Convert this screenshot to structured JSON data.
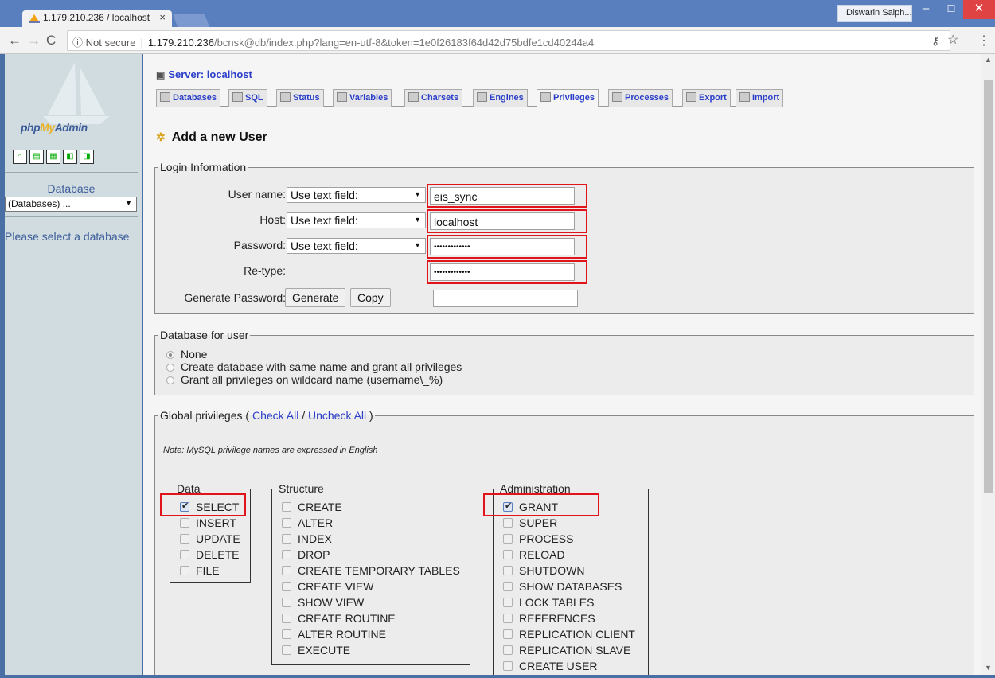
{
  "browser": {
    "tab_title": "1.179.210.236 / localhost",
    "tab_close": "×",
    "user_name": "Diswarin Saiph...",
    "win_min": "–",
    "win_max": "☐",
    "win_close": "✕",
    "nav_back": "←",
    "nav_forward": "→",
    "nav_reload": "C",
    "security_label": "ⓘ Not secure",
    "url_host": "1.179.210.236",
    "url_path": "/bcnsk@db/index.php?lang=en-utf-8&token=1e0f26183f64d42d75bdfe1cd40244a4",
    "key_icon": "⚷",
    "star_icon": "☆",
    "menu_icon": "⋮"
  },
  "sidebar": {
    "logo_text_1": "php",
    "logo_text_2": "My",
    "logo_text_3": "Admin",
    "db_label": "Database",
    "db_select_value": "(Databases) ...",
    "message": "Please select a database"
  },
  "server": {
    "title": "Server: localhost",
    "tabs": [
      {
        "label": "Databases"
      },
      {
        "label": "SQL"
      },
      {
        "label": "Status"
      },
      {
        "label": "Variables"
      },
      {
        "label": "Charsets"
      },
      {
        "label": "Engines"
      },
      {
        "label": "Privileges"
      },
      {
        "label": "Processes"
      },
      {
        "label": "Export"
      },
      {
        "label": "Import"
      }
    ]
  },
  "page": {
    "heading": "Add a new User"
  },
  "login": {
    "legend": "Login Information",
    "username_label": "User name:",
    "username_mode": "Use text field:",
    "username_value": "eis_sync",
    "host_label": "Host:",
    "host_mode": "Use text field:",
    "host_value": "localhost",
    "password_label": "Password:",
    "password_mode": "Use text field:",
    "password_value": "•••••••••••••",
    "retype_label": "Re-type:",
    "retype_value": "•••••••••••••",
    "generate_label": "Generate Password:",
    "generate_button": "Generate",
    "copy_button": "Copy",
    "generated_value": ""
  },
  "database_for_user": {
    "legend": "Database for user",
    "options": [
      {
        "label": "None",
        "selected": true
      },
      {
        "label": "Create database with same name and grant all privileges",
        "selected": false
      },
      {
        "label": "Grant all privileges on wildcard name (username\\_%)",
        "selected": false
      }
    ]
  },
  "global": {
    "legend_prefix": "Global privileges (",
    "check_all": "Check All",
    "slash": " / ",
    "uncheck_all": "Uncheck All",
    "legend_suffix": ")",
    "note": "Note: MySQL privilege names are expressed in English",
    "data_legend": "Data",
    "data": [
      {
        "label": "SELECT",
        "checked": true
      },
      {
        "label": "INSERT",
        "checked": false
      },
      {
        "label": "UPDATE",
        "checked": false
      },
      {
        "label": "DELETE",
        "checked": false
      },
      {
        "label": "FILE",
        "checked": false
      }
    ],
    "structure_legend": "Structure",
    "structure": [
      {
        "label": "CREATE",
        "checked": false
      },
      {
        "label": "ALTER",
        "checked": false
      },
      {
        "label": "INDEX",
        "checked": false
      },
      {
        "label": "DROP",
        "checked": false
      },
      {
        "label": "CREATE TEMPORARY TABLES",
        "checked": false
      },
      {
        "label": "CREATE VIEW",
        "checked": false
      },
      {
        "label": "SHOW VIEW",
        "checked": false
      },
      {
        "label": "CREATE ROUTINE",
        "checked": false
      },
      {
        "label": "ALTER ROUTINE",
        "checked": false
      },
      {
        "label": "EXECUTE",
        "checked": false
      }
    ],
    "admin_legend": "Administration",
    "admin": [
      {
        "label": "GRANT",
        "checked": true
      },
      {
        "label": "SUPER",
        "checked": false
      },
      {
        "label": "PROCESS",
        "checked": false
      },
      {
        "label": "RELOAD",
        "checked": false
      },
      {
        "label": "SHUTDOWN",
        "checked": false
      },
      {
        "label": "SHOW DATABASES",
        "checked": false
      },
      {
        "label": "LOCK TABLES",
        "checked": false
      },
      {
        "label": "REFERENCES",
        "checked": false
      },
      {
        "label": "REPLICATION CLIENT",
        "checked": false
      },
      {
        "label": "REPLICATION SLAVE",
        "checked": false
      },
      {
        "label": "CREATE USER",
        "checked": false
      }
    ]
  },
  "colors": {
    "link": "#2a3ec9",
    "highlight": "#e0141a",
    "sidebar_bg": "#d0dce0",
    "main_bg": "#f5f5f5"
  }
}
